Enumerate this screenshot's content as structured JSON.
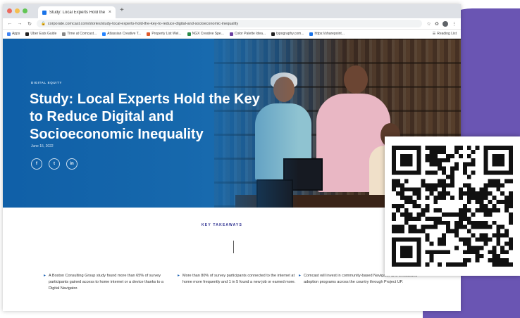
{
  "browser": {
    "tab_title": "Study: Local Experts Hold the ...",
    "tab_close": "×",
    "new_tab": "+",
    "url": "corporate.comcast.com/stories/study-local-experts-hold-the-key-to-reduce-digital-and-socioeconomic-inequality",
    "bookmarks": [
      {
        "label": "Apps",
        "color": "#4285f4"
      },
      {
        "label": "Uber Eats Guide",
        "color": "#222222"
      },
      {
        "label": "Time at Comcast...",
        "color": "#888888"
      },
      {
        "label": "Atlassian Creative T...",
        "color": "#2684ff"
      },
      {
        "label": "Property List Wel...",
        "color": "#e05a2b"
      },
      {
        "label": "NGX Creative Spe...",
        "color": "#2a8a4a"
      },
      {
        "label": "Color Palette Idea...",
        "color": "#6b3fa0"
      },
      {
        "label": "typography.com...",
        "color": "#222222"
      },
      {
        "label": "https://sharepoint...",
        "color": "#1a73e8"
      }
    ],
    "reading_list": "Reading List"
  },
  "hero": {
    "eyebrow": "DIGITAL EQUITY",
    "title": "Study: Local Experts Hold the Key to Reduce Digital and Socioeconomic Inequality",
    "date": "June 15, 2022",
    "social": [
      "f",
      "t",
      "in"
    ]
  },
  "takeaways": {
    "heading": "KEY TAKEAWAYS",
    "items": [
      "A Boston Consulting Group study found more than 65% of survey participants gained access to home internet or a device thanks to a Digital Navigator.",
      "More than 80% of survey participants connected to the internet at home more frequently and 1 in 5 found a new job or earned more.",
      "Comcast will invest in community-based Navigator and broadband adoption programs across the country through Project UP."
    ]
  },
  "colors": {
    "purple_backdrop": "#6a55b3",
    "hero_blue": "#1566ad",
    "heading_navy": "#2b2e8f"
  }
}
